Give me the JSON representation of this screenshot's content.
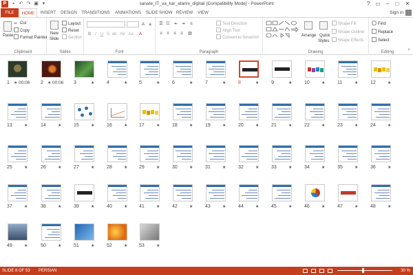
{
  "window": {
    "title": "sanate_IT_va_kar_afarini_digitali [Compatibility Mode] - PowerPoint",
    "minimize": "–",
    "restore": "□",
    "close": "✕",
    "help": "?"
  },
  "tabs": [
    "FILE",
    "HOME",
    "INSERT",
    "DESIGN",
    "TRANSITIONS",
    "ANIMATIONS",
    "SLIDE SHOW",
    "REVIEW",
    "VIEW"
  ],
  "active_tab": "HOME",
  "signin": "Sign in",
  "ribbon": {
    "clipboard": {
      "label": "Clipboard",
      "paste": "Paste",
      "cut": "Cut",
      "copy": "Copy",
      "format_painter": "Format Painter"
    },
    "slides": {
      "label": "Slides",
      "new_slide_1": "New",
      "new_slide_2": "Slide",
      "layout": "Layout",
      "reset": "Reset",
      "section": "Section"
    },
    "font": {
      "label": "Font"
    },
    "paragraph": {
      "label": "Paragraph",
      "text_direction": "Text Direction",
      "align_text": "Align Text",
      "convert": "Convert to SmartArt"
    },
    "drawing": {
      "label": "Drawing",
      "arrange": "Arrange",
      "quick_styles_1": "Quick",
      "quick_styles_2": "Styles",
      "shape_fill": "Shape Fill",
      "shape_outline": "Shape Outline",
      "shape_effects": "Shape Effects"
    },
    "editing": {
      "label": "Editing",
      "find": "Find",
      "replace": "Replace",
      "select": "Select"
    }
  },
  "slides": [
    {
      "num": "1",
      "time": "00:06",
      "kind": "photo-dark"
    },
    {
      "num": "2",
      "time": "00:06",
      "kind": "photo-candle"
    },
    {
      "num": "3",
      "kind": "photo-green"
    },
    {
      "num": "4",
      "kind": "text"
    },
    {
      "num": "5",
      "kind": "text"
    },
    {
      "num": "6",
      "kind": "text"
    },
    {
      "num": "7",
      "kind": "text"
    },
    {
      "num": "8",
      "kind": "title-big",
      "selected": true
    },
    {
      "num": "9",
      "kind": "title-big"
    },
    {
      "num": "10",
      "kind": "word-art"
    },
    {
      "num": "11",
      "kind": "text"
    },
    {
      "num": "12",
      "kind": "word-art-yellow"
    },
    {
      "num": "13",
      "kind": "text"
    },
    {
      "num": "14",
      "kind": "text"
    },
    {
      "num": "15",
      "kind": "diagram"
    },
    {
      "num": "16",
      "kind": "chart"
    },
    {
      "num": "17",
      "kind": "word-art-yellow"
    },
    {
      "num": "18",
      "kind": "text"
    },
    {
      "num": "19",
      "kind": "text"
    },
    {
      "num": "20",
      "kind": "text"
    },
    {
      "num": "21",
      "kind": "text"
    },
    {
      "num": "22",
      "kind": "text"
    },
    {
      "num": "23",
      "kind": "text"
    },
    {
      "num": "24",
      "kind": "text"
    },
    {
      "num": "25",
      "kind": "text"
    },
    {
      "num": "26",
      "kind": "text"
    },
    {
      "num": "27",
      "kind": "text"
    },
    {
      "num": "28",
      "kind": "text"
    },
    {
      "num": "29",
      "kind": "text"
    },
    {
      "num": "30",
      "kind": "text"
    },
    {
      "num": "31",
      "kind": "text"
    },
    {
      "num": "32",
      "kind": "text"
    },
    {
      "num": "33",
      "kind": "text"
    },
    {
      "num": "34",
      "kind": "text"
    },
    {
      "num": "35",
      "kind": "text"
    },
    {
      "num": "36",
      "kind": "text"
    },
    {
      "num": "37",
      "kind": "text"
    },
    {
      "num": "38",
      "kind": "text"
    },
    {
      "num": "39",
      "kind": "title-big"
    },
    {
      "num": "40",
      "kind": "text"
    },
    {
      "num": "41",
      "kind": "text"
    },
    {
      "num": "42",
      "kind": "text"
    },
    {
      "num": "43",
      "kind": "text"
    },
    {
      "num": "44",
      "kind": "text"
    },
    {
      "num": "45",
      "kind": "text"
    },
    {
      "num": "46",
      "kind": "pie"
    },
    {
      "num": "47",
      "kind": "title-red"
    },
    {
      "num": "48",
      "kind": "text"
    },
    {
      "num": "49",
      "kind": "photo-city"
    },
    {
      "num": "50",
      "kind": "text"
    },
    {
      "num": "51",
      "kind": "photo-blue"
    },
    {
      "num": "52",
      "kind": "photo-orange"
    },
    {
      "num": "53",
      "kind": "photo-laptop"
    }
  ],
  "status": {
    "slide": "SLIDE 8 OF 53",
    "language": "PERSIAN",
    "zoom": "30 %"
  },
  "colors": {
    "accent": "#c43e1c",
    "selection": "#d24726",
    "slide_header": "#2f6fad"
  }
}
